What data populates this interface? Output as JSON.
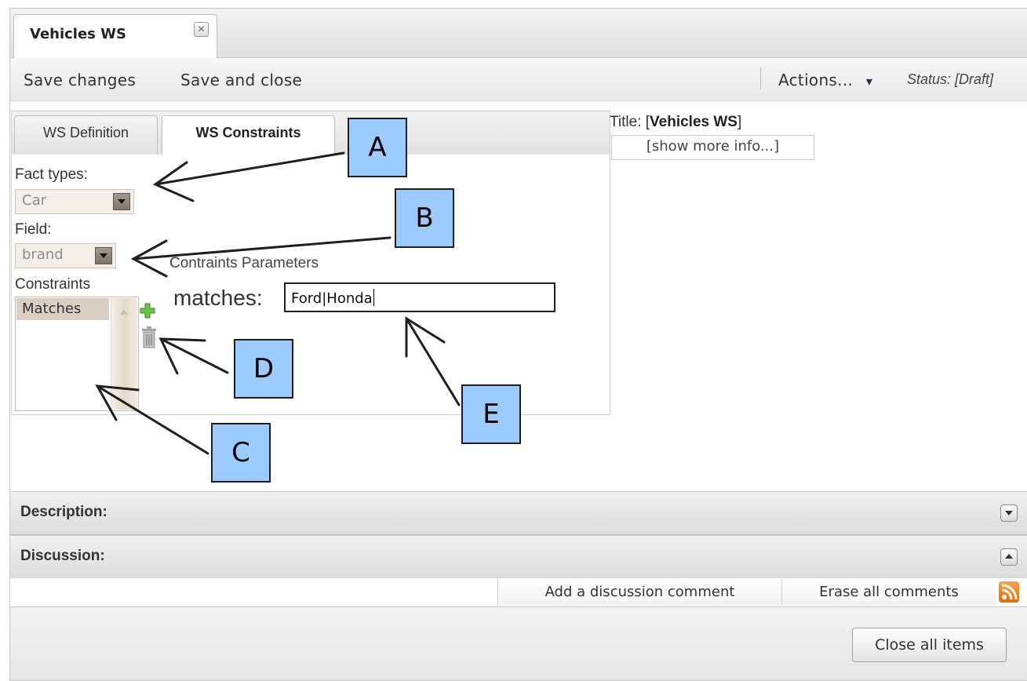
{
  "tab": {
    "title": "Vehicles WS",
    "close_glyph": "✕"
  },
  "toolbar": {
    "save_changes": "Save changes",
    "save_and_close": "Save and close",
    "actions": "Actions...",
    "actions_arrow": "▾",
    "status": "Status: [Draft]"
  },
  "constraint_tabs": [
    {
      "label": "WS Definition"
    },
    {
      "label": "WS Constraints",
      "active": true
    }
  ],
  "form": {
    "fact_types_label": "Fact types:",
    "fact_type_value": "Car",
    "field_label": "Field:",
    "field_value": "brand",
    "constraints_label": "Constraints",
    "constraints_items": [
      "Matches"
    ],
    "params_label": "Contraints Parameters",
    "matches_label": "matches:",
    "matches_value": "Ford|Honda"
  },
  "meta": {
    "title_prefix": "Title: [",
    "title_value": "Vehicles WS",
    "title_suffix": "]",
    "show_more": "[show more info...]"
  },
  "sections": {
    "description": "Description:",
    "discussion": "Discussion:"
  },
  "discussion_actions": {
    "add_comment": "Add a discussion comment",
    "erase_comments": "Erase all comments"
  },
  "footer": {
    "close_all": "Close all items"
  },
  "callouts": [
    "A",
    "B",
    "C",
    "D",
    "E"
  ],
  "icons": {
    "add": "plus-icon",
    "delete": "trash-icon",
    "rss": "rss-icon"
  },
  "colors": {
    "callout_fill": "#9ccbff",
    "add_icon": "#6cc04a",
    "rss": "#f08a24"
  }
}
